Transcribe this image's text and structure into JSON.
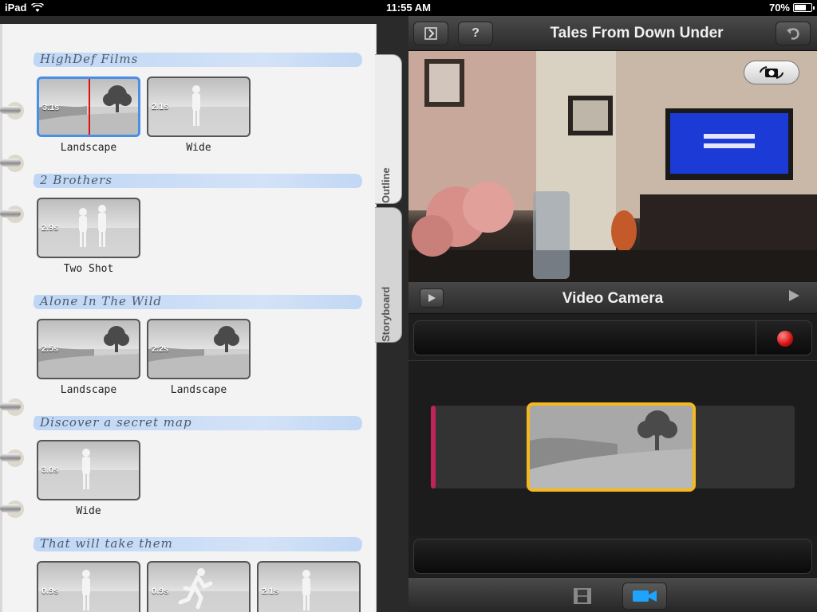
{
  "status_bar": {
    "device": "iPad",
    "time": "11:55 AM",
    "battery": "70%",
    "battery_fraction": 0.7
  },
  "project": {
    "title": "Tales From Down Under"
  },
  "tabs": [
    {
      "label": "Outline"
    },
    {
      "label": "Storyboard"
    }
  ],
  "sections": [
    {
      "title": "HighDef Films",
      "shots": [
        {
          "duration": "3.1s",
          "label": "Landscape"
        },
        {
          "duration": "2.1s",
          "label": "Wide"
        }
      ]
    },
    {
      "title": "2 Brothers",
      "shots": [
        {
          "duration": "2.9s",
          "label": "Two Shot"
        }
      ]
    },
    {
      "title": "Alone In The Wild",
      "shots": [
        {
          "duration": "2.5s",
          "label": "Landscape"
        },
        {
          "duration": "2.2s",
          "label": "Landscape"
        }
      ]
    },
    {
      "title": "Discover a secret map",
      "shots": [
        {
          "duration": "3.0s",
          "label": "Wide"
        }
      ]
    },
    {
      "title": "That will take them",
      "shots": [
        {
          "duration": "0.9s"
        },
        {
          "duration": "0.9s"
        },
        {
          "duration": "2.1s"
        }
      ]
    }
  ],
  "camera": {
    "label": "Video Camera"
  },
  "icons": {
    "settings": "export-icon",
    "help": "?",
    "undo": "undo-icon",
    "flip_camera": "camera-flip-icon",
    "play": "play-icon",
    "next": "next-icon",
    "record": "record-icon",
    "clips": "film-strip-icon",
    "camera": "video-camera-icon"
  },
  "colors": {
    "accent": "#f3b91e",
    "record": "#d41010",
    "selection": "#4a8fe6"
  }
}
